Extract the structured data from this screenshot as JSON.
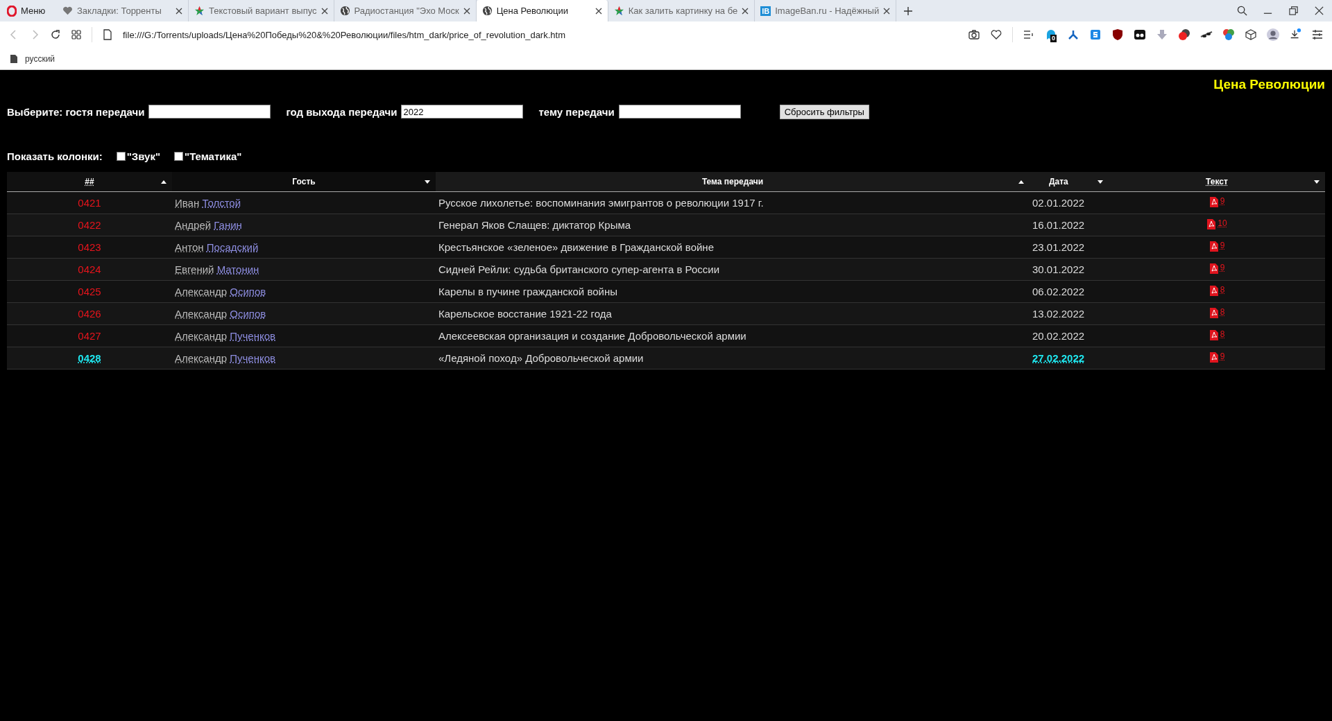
{
  "browser": {
    "menu_label": "Меню",
    "tabs": [
      {
        "title": "Закладки: Торренты",
        "kind": "heart",
        "selected": false
      },
      {
        "title": "Текстовый вариант выпус",
        "kind": "star",
        "selected": false
      },
      {
        "title": "Радиостанция \"Эхо Моск",
        "kind": "globe",
        "selected": false
      },
      {
        "title": "Цена Революции",
        "kind": "globe",
        "selected": true
      },
      {
        "title": "Как залить картинку на бе",
        "kind": "star",
        "selected": false
      },
      {
        "title": "ImageBan.ru - Надёжный",
        "kind": "logo",
        "logo_text": "IB",
        "selected": false
      }
    ],
    "address": "file:///G:/Torrents/uploads/Цена%20Победы%20&%20Революции/files/htm_dark/price_of_revolution_dark.htm",
    "extension_badge": "0",
    "bookmarks": [
      {
        "label": "русский"
      }
    ]
  },
  "page": {
    "title": "Цена Революции",
    "filters": [
      {
        "label": "Выберите: гостя передачи"
      },
      {
        "label": "год выхода передачи",
        "value": "2022"
      },
      {
        "label": "тему передачи"
      }
    ],
    "reset_button": "Сбросить фильтры",
    "show_columns": {
      "label": "Показать колонки:",
      "options": [
        {
          "label": "\"Звук\"",
          "checked": false
        },
        {
          "label": "\"Тематика\"",
          "checked": false
        }
      ]
    },
    "table": {
      "columns": [
        {
          "label": "##",
          "link": true,
          "ascending": true
        },
        {
          "label": "Гость",
          "link": false,
          "ascending": false
        },
        {
          "label": "Тема передачи",
          "link": false,
          "ascending": true
        },
        {
          "label": "Дата",
          "link": false,
          "ascending": false
        },
        {
          "label": "Текст",
          "link": true,
          "ascending": false
        }
      ],
      "rows": [
        {
          "number": "0421",
          "first_name": "Иван",
          "last_name": "Толстой",
          "topic": "Русское лихолетье: воспоминания эмигрантов о революции 1917 г.",
          "date": "02.01.2022",
          "pages": "9",
          "selected": false
        },
        {
          "number": "0422",
          "first_name": "Андрей",
          "last_name": "Ганин",
          "topic": "Генерал Яков Слащев: диктатор Крыма",
          "date": "16.01.2022",
          "pages": "10",
          "selected": false
        },
        {
          "number": "0423",
          "first_name": "Антон",
          "last_name": "Посадский",
          "topic": "Крестьянское «зеленое» движение в Гражданской войне",
          "date": "23.01.2022",
          "pages": "9",
          "selected": false
        },
        {
          "number": "0424",
          "first_name": "Евгений",
          "last_name": "Матонин",
          "topic": "Сидней Рейли: судьба британского супер-агента в России",
          "date": "30.01.2022",
          "pages": "9",
          "selected": false
        },
        {
          "number": "0425",
          "first_name": "Александр",
          "last_name": "Осипов",
          "topic": "Карелы в пучине гражданской войны",
          "date": "06.02.2022",
          "pages": "8",
          "selected": false
        },
        {
          "number": "0426",
          "first_name": "Александр",
          "last_name": "Осипов",
          "topic": "Карельское восстание 1921-22 года",
          "date": "13.02.2022",
          "pages": "8",
          "selected": false
        },
        {
          "number": "0427",
          "first_name": "Александр",
          "last_name": "Пученков",
          "topic": "Алексеевская организация и создание Добровольческой армии",
          "date": "20.02.2022",
          "pages": "8",
          "selected": false
        },
        {
          "number": "0428",
          "first_name": "Александр",
          "last_name": "Пученков",
          "topic": "«Ледяной поход» Добровольческой армии",
          "date": "27.02.2022",
          "pages": "9",
          "selected": true
        }
      ]
    }
  }
}
